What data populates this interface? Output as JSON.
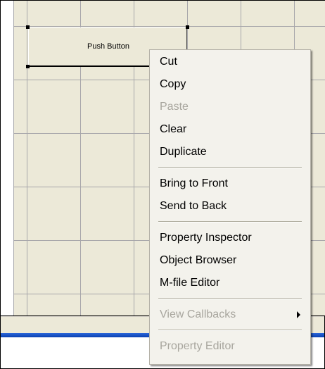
{
  "canvas": {
    "push_button_label": "Push Button"
  },
  "context_menu": {
    "items": [
      {
        "label": "Cut",
        "enabled": true
      },
      {
        "label": "Copy",
        "enabled": true
      },
      {
        "label": "Paste",
        "enabled": false
      },
      {
        "label": "Clear",
        "enabled": true
      },
      {
        "label": "Duplicate",
        "enabled": true
      },
      {
        "label": "Bring to Front",
        "enabled": true
      },
      {
        "label": "Send to Back",
        "enabled": true
      },
      {
        "label": "Property Inspector",
        "enabled": true
      },
      {
        "label": "Object Browser",
        "enabled": true
      },
      {
        "label": "M-file Editor",
        "enabled": true
      },
      {
        "label": "View Callbacks",
        "enabled": false,
        "submenu_icon": "chevron-right-icon"
      },
      {
        "label": "Property Editor",
        "enabled": false
      }
    ]
  },
  "colors": {
    "grid_background": "#ece9d8",
    "grid_line": "#a7a6aa",
    "menu_background": "#f3f2ec",
    "disabled_text": "#a8a69e",
    "selection_bar": "#2b66d9"
  }
}
